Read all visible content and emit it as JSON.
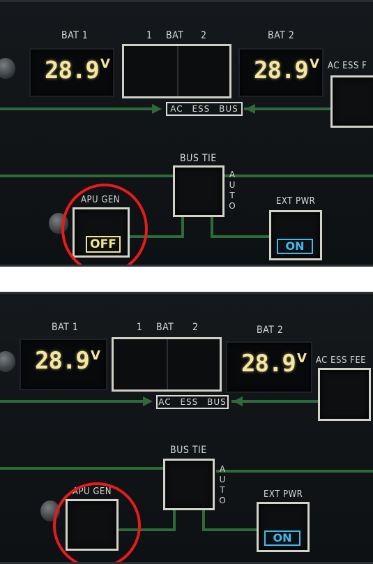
{
  "panels": [
    {
      "bat1_label": "BAT 1",
      "bat2_label": "BAT 2",
      "bat_pair_label_left": "1",
      "bat_pair_label_mid": "BAT",
      "bat_pair_label_right": "2",
      "bat1_voltage": "28.9",
      "bat2_voltage": "28.9",
      "voltage_unit": "V",
      "ac_ess_bus_label": "AC ESS BUS",
      "ac_ess_feed_label": "AC ESS F",
      "bus_tie_label": "BUS TIE",
      "auto_label": "AUTO",
      "apu_gen_label": "APU GEN",
      "apu_gen_status": "OFF",
      "ext_pwr_label": "EXT PWR",
      "ext_pwr_status": "ON"
    },
    {
      "bat1_label": "BAT 1",
      "bat2_label": "BAT 2",
      "bat_pair_label_left": "1",
      "bat_pair_label_mid": "BAT",
      "bat_pair_label_right": "2",
      "bat1_voltage": "28.9",
      "bat2_voltage": "28.9",
      "voltage_unit": "V",
      "ac_ess_bus_label": "AC ESS BUS",
      "ac_ess_feed_label": "AC ESS FEE",
      "bus_tie_label": "BUS TIE",
      "auto_label": "AUTO",
      "apu_gen_label": "APU GEN",
      "apu_gen_status": "",
      "ext_pwr_label": "EXT PWR",
      "ext_pwr_status": "ON"
    }
  ],
  "colors": {
    "lcd_digits": "#f3e7a2",
    "off_light": "#f0e88a",
    "on_light": "#46b8e8",
    "wire": "#2f6b3a",
    "highlight_circle": "#e61b1b"
  },
  "icons": {
    "knob": "rotary-knob-icon",
    "arrow": "flow-arrow-icon"
  }
}
